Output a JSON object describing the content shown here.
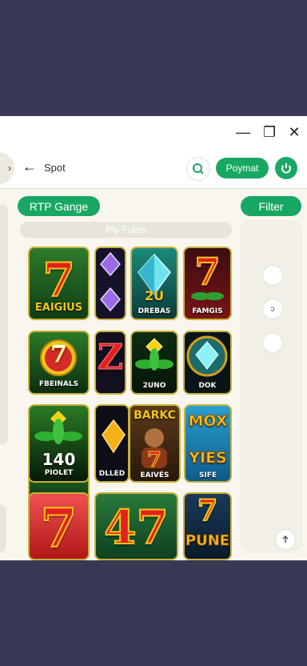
{
  "window": {
    "controls": {
      "minimize": "—",
      "maximize": "❐",
      "close": "✕"
    }
  },
  "toolbar": {
    "side_tab": "›",
    "back": "←",
    "title": "Spot",
    "pay_label": "Poymat"
  },
  "chips": {
    "rtp_label": "RTP Gange",
    "filter_label": "Filter",
    "subbar_label": "Ply Fubts"
  },
  "side_panel": {
    "second_circle": "ↄ"
  },
  "games": [
    {
      "label": "EAIGIUS",
      "big": "7"
    },
    {
      "label": ""
    },
    {
      "label": "DREBAS",
      "big": "2U"
    },
    {
      "label": "FAMGIS",
      "big": "7"
    },
    {
      "label": "FBEINALS",
      "big": "7"
    },
    {
      "label": "",
      "big": "Z"
    },
    {
      "label": "2UNO"
    },
    {
      "label": "DOK"
    },
    {
      "label": "PIOLET",
      "big": "140"
    },
    {
      "label": "DLLED"
    },
    {
      "label": "EAIVÉS",
      "big": "BARKC"
    },
    {
      "label": "SIFE",
      "big": "MOX",
      "big2": "YIES"
    },
    {
      "label": "",
      "big": "7"
    },
    {
      "label": "",
      "big": "47"
    },
    {
      "label": "PUNE",
      "big": "7"
    }
  ],
  "colors": {
    "accent_green": "#18a864",
    "page_bg": "#383a55",
    "window_bg": "#f8f6ee"
  }
}
